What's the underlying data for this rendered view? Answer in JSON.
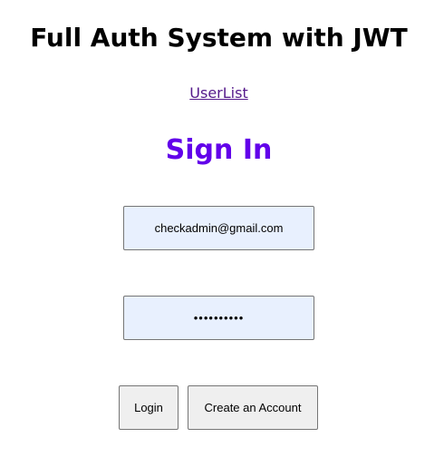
{
  "header": {
    "title": "Full Auth System with JWT"
  },
  "nav": {
    "userlist_link": "UserList"
  },
  "signin": {
    "title": "Sign In",
    "email_value": "checkadmin@gmail.com",
    "password_value": "••••••••••",
    "login_label": "Login",
    "create_account_label": "Create an Account"
  },
  "colors": {
    "title_accent": "#6200ea",
    "input_background": "#e8f0fe",
    "button_background": "#efefef",
    "link": "#551a8b"
  }
}
